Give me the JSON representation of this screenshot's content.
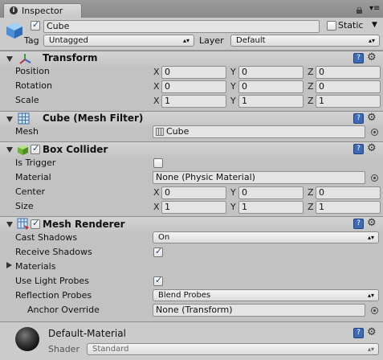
{
  "window": {
    "tab_label": "Inspector"
  },
  "object": {
    "name": "Cube",
    "static_label": "Static",
    "tag_label": "Tag",
    "tag_value": "Untagged",
    "layer_label": "Layer",
    "layer_value": "Default"
  },
  "transform": {
    "title": "Transform",
    "rows": [
      {
        "label": "Position",
        "x": "0",
        "y": "0",
        "z": "0"
      },
      {
        "label": "Rotation",
        "x": "0",
        "y": "0",
        "z": "0"
      },
      {
        "label": "Scale",
        "x": "1",
        "y": "1",
        "z": "1"
      }
    ],
    "axis": {
      "x": "X",
      "y": "Y",
      "z": "Z"
    }
  },
  "mesh_filter": {
    "title": "Cube (Mesh Filter)",
    "mesh_label": "Mesh",
    "mesh_value": "Cube"
  },
  "box_collider": {
    "title": "Box Collider",
    "is_trigger_label": "Is Trigger",
    "material_label": "Material",
    "material_value": "None (Physic Material)",
    "center_label": "Center",
    "center": {
      "x": "0",
      "y": "0",
      "z": "0"
    },
    "size_label": "Size",
    "size": {
      "x": "1",
      "y": "1",
      "z": "1"
    }
  },
  "mesh_renderer": {
    "title": "Mesh Renderer",
    "cast_shadows_label": "Cast Shadows",
    "cast_shadows_value": "On",
    "receive_shadows_label": "Receive Shadows",
    "materials_label": "Materials",
    "light_probes_label": "Use Light Probes",
    "reflection_probes_label": "Reflection Probes",
    "reflection_probes_value": "Blend Probes",
    "anchor_override_label": "Anchor Override",
    "anchor_override_value": "None (Transform)"
  },
  "material": {
    "name": "Default-Material",
    "shader_label": "Shader",
    "shader_value": "Standard"
  },
  "colors": {
    "background": "#c2c2c2",
    "header": "#c4c4c4",
    "field": "#e4e4e4",
    "help_blue": "#3d6ab5"
  }
}
